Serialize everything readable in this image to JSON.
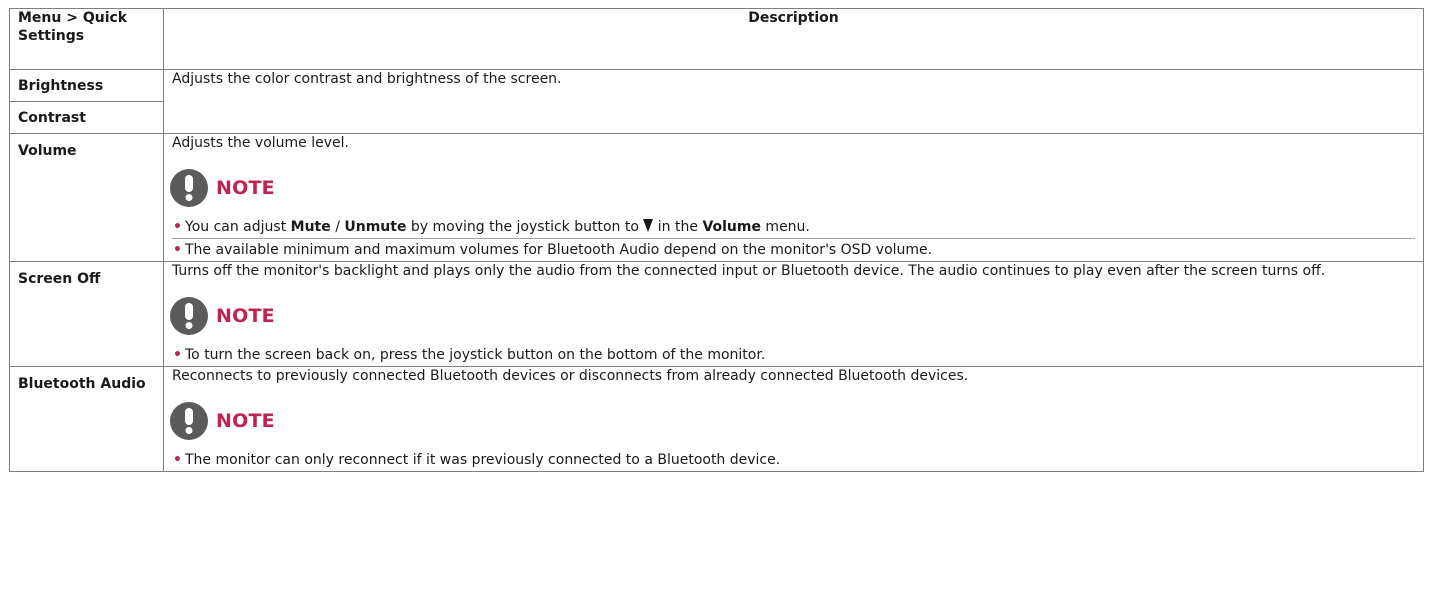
{
  "table": {
    "header": {
      "col1": "Menu > Quick Settings",
      "col2": "Description"
    },
    "brightness": {
      "label": "Brightness"
    },
    "contrast": {
      "label": "Contrast"
    },
    "brightness_contrast_desc": "Adjusts the color contrast and brightness of the screen.",
    "volume": {
      "label": "Volume",
      "desc": "Adjusts the volume level.",
      "note_title": "NOTE",
      "bullet1": {
        "t1": "You can adjust ",
        "mute": "Mute",
        "sep": " / ",
        "unmute": "Unmute",
        "t2": " by moving the joystick button to ",
        "t3": " in the ",
        "menu": "Volume",
        "t4": " menu."
      },
      "bullet2": "The available minimum and maximum volumes for Bluetooth Audio depend on the monitor's OSD volume."
    },
    "screen_off": {
      "label": "Screen Off",
      "desc": "Turns off the monitor's backlight and plays only the audio from the connected input or Bluetooth device. The audio continues to play even after the screen turns off.",
      "note_title": "NOTE",
      "bullet1": "To turn the screen back on, press the joystick button on the bottom of the monitor."
    },
    "bluetooth_audio": {
      "label": "Bluetooth Audio",
      "desc": "Reconnects to previously connected Bluetooth devices or disconnects from already connected Bluetooth devices.",
      "note_title": "NOTE",
      "bullet1": "The monitor can only reconnect if it was previously connected to a Bluetooth device."
    }
  },
  "colors": {
    "accent": "#c0234f",
    "note_icon": "#5b5b5b",
    "border": "#7f7f7f"
  },
  "icons": {
    "note": "exclamation-icon",
    "bullet": "bullet-dot",
    "down": "down-triangle-icon"
  }
}
